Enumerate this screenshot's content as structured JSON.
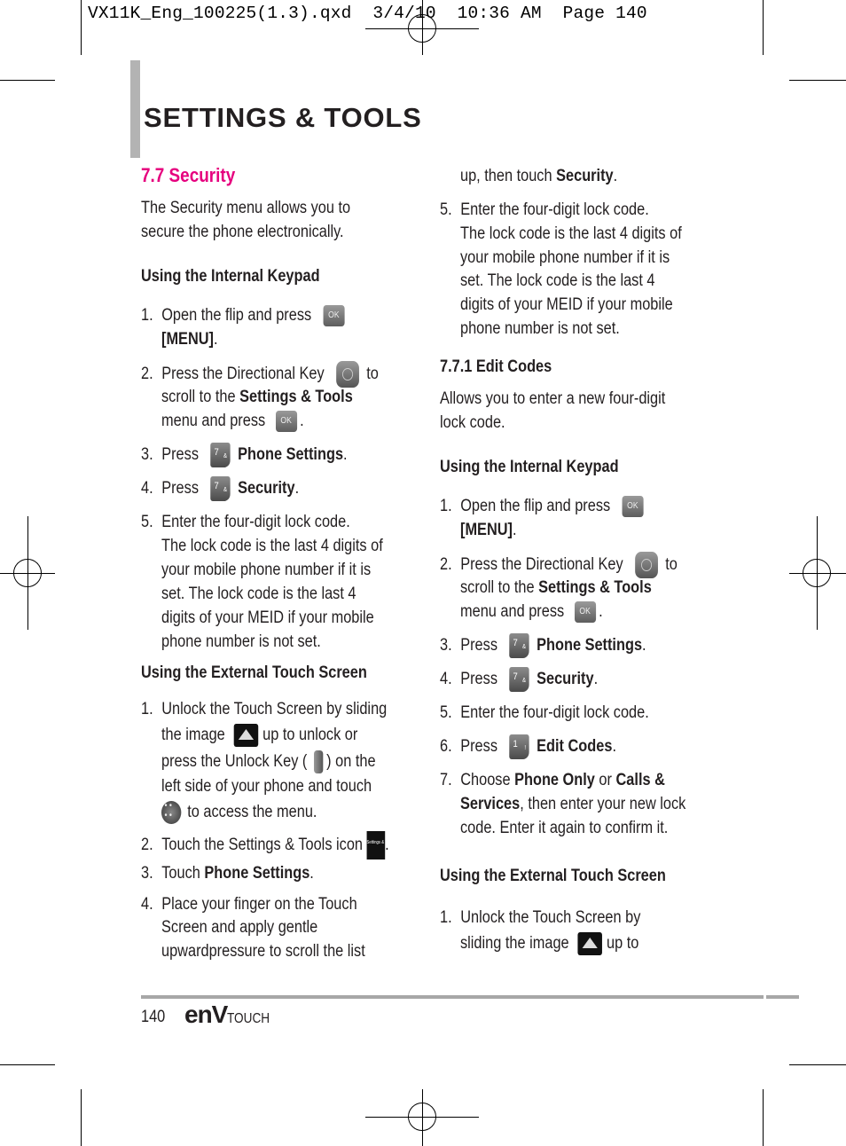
{
  "slug": "VX11K_Eng_100225(1.3).qxd  3/4/10  10:36 AM  Page 140",
  "page_title": "SETTINGS & TOOLS",
  "section_heading": "7.7 Security",
  "accent_color": "#e6007e",
  "left": {
    "intro": [
      "The Security menu allows you to",
      "secure the phone electronically."
    ],
    "internal_heading": "Using the Internal Keypad",
    "internal_steps": {
      "s1_num": "1.",
      "s1_a": "Open the flip and press",
      "s1_b": "[MENU]",
      "s1_c": ".",
      "s2_num": "2.",
      "s2_a": "Press the Directional Key",
      "s2_b": "to",
      "s2_c": "scroll to the",
      "s2_d": "Settings & Tools",
      "s2_e": "menu and press",
      "s2_f": ".",
      "s3_num": "3.",
      "s3_a": "Press",
      "s3_b": "Phone Settings",
      "s3_c": ".",
      "s4_num": "4.",
      "s4_a": "Press",
      "s4_b": "Security",
      "s4_c": ".",
      "s5_num": "5.",
      "s5_lines": [
        "Enter the four-digit lock code.",
        "The lock code is the last 4 digits of",
        "your mobile phone number if it is",
        "set. The lock code is the last 4",
        "digits of your MEID if your mobile",
        "phone number is not set."
      ]
    },
    "external_heading": "Using the External Touch Screen",
    "external_steps": {
      "s1_num": "1.",
      "s1_l1": "Unlock the Touch Screen by sliding",
      "s1_l2a": "the image",
      "s1_l2b": "up to unlock or",
      "s1_l3a": "press the Unlock Key (",
      "s1_l3b": ") on the",
      "s1_l4": "left side of your phone and touch",
      "s1_l5": "to access the menu.",
      "s2_num": "2.",
      "s2_a": "Touch the Settings & Tools icon",
      "s2_b": ".",
      "s3_num": "3.",
      "s3_a": "Touch",
      "s3_b": "Phone Settings",
      "s3_c": ".",
      "s4_num": "4.",
      "s4_lines": [
        "Place your finger on the Touch",
        "Screen and apply gentle",
        "upwardpressure to scroll the list"
      ]
    }
  },
  "right": {
    "cont_a": "up, then touch",
    "cont_b": "Security",
    "cont_c": ".",
    "s5_num": "5.",
    "s5_lines": [
      "Enter the four-digit lock code.",
      "The lock code is the last 4 digits of",
      "your mobile phone number if it is",
      "set. The lock code is the last 4",
      "digits of your MEID if your mobile",
      "phone number is not set."
    ],
    "edit_heading": "7.7.1 Edit Codes",
    "edit_intro": [
      "Allows you to enter a new four-digit",
      "lock code."
    ],
    "internal_heading": "Using the Internal Keypad",
    "steps": {
      "s1_num": "1.",
      "s1_a": "Open the flip and press",
      "s1_b": "[MENU]",
      "s1_c": ".",
      "s2_num": "2.",
      "s2_a": "Press the Directional Key",
      "s2_b": "to",
      "s2_c": "scroll to the",
      "s2_d": "Settings & Tools",
      "s2_e": "menu and press",
      "s2_f": ".",
      "s3_num": "3.",
      "s3_a": "Press",
      "s3_b": "Phone Settings",
      "s3_c": ".",
      "s4_num": "4.",
      "s4_a": "Press",
      "s4_b": "Security",
      "s4_c": ".",
      "s5_num": "5.",
      "s5_a": "Enter the four-digit lock code.",
      "s6_num": "6.",
      "s6_a": "Press",
      "s6_b": "Edit Codes",
      "s6_c": ".",
      "s7_num": "7.",
      "s7_a": "Choose",
      "s7_b": "Phone Only",
      "s7_c": "or",
      "s7_d": "Calls &",
      "s7_e": "Services",
      "s7_f": ", then enter your new lock",
      "s7_g": "code. Enter it again to confirm it."
    },
    "external_heading": "Using the External Touch Screen",
    "ext_s1_num": "1.",
    "ext_s1_l1": "Unlock the Touch Screen by",
    "ext_s1_l2a": "sliding the image",
    "ext_s1_l2b": "up to"
  },
  "icons": {
    "ok_label": "OK",
    "key7_digit": "7",
    "key7_sym": "&",
    "key1_digit": "1",
    "key1_sym": "!",
    "settings_label": "Settings & Tools"
  },
  "footer": {
    "page_number": "140",
    "brand_env": "enV",
    "brand_touch": "TOUCH"
  }
}
